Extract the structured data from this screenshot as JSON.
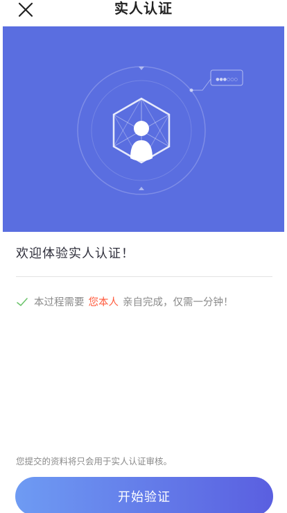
{
  "header": {
    "title": "实人认证"
  },
  "banner": {
    "bubble_text": "●●●○○○"
  },
  "welcome": {
    "text": "欢迎体验实人认证！"
  },
  "notice": {
    "prefix": "本过程需要",
    "highlight": "您本人",
    "suffix": "亲自完成，仅需一分钟！"
  },
  "privacy": {
    "text": "您提交的资料将只会用于实人认证审核。"
  },
  "actions": {
    "start_label": "开始验证"
  },
  "colors": {
    "banner_bg": "#5a6ee0",
    "accent": "#ff5a3c",
    "button_gradient_start": "#6e9bf3",
    "button_gradient_end": "#5a5fe0",
    "check": "#6cc46c"
  },
  "icons": {
    "close": "close-icon",
    "check": "check-icon",
    "user": "user-icon"
  }
}
